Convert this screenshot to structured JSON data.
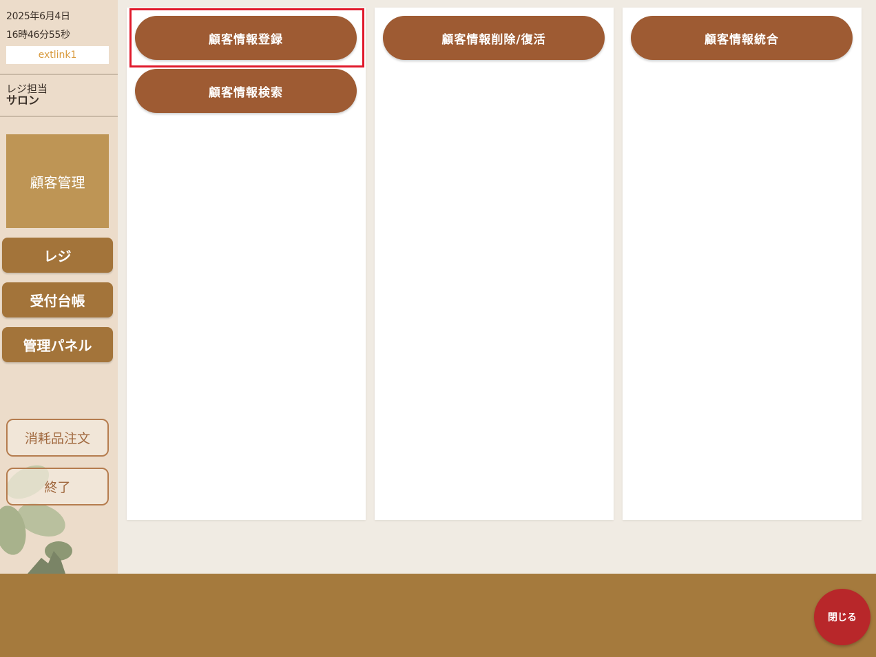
{
  "sidebar": {
    "date": "2025年6月4日",
    "time": "16時46分55秒",
    "user": "extlink1",
    "staff_label": "レジ担当",
    "staff_name": "サロン",
    "active_nav": "顧客管理",
    "nav": [
      {
        "label": "レジ"
      },
      {
        "label": "受付台帳"
      },
      {
        "label": "管理パネル"
      }
    ],
    "supply_order": "消耗品注文",
    "exit": "終了"
  },
  "panels": {
    "register": "顧客情報登録",
    "search": "顧客情報検索",
    "delete_restore": "顧客情報削除/復活",
    "merge": "顧客情報統合"
  },
  "footer": {
    "close": "閉じる"
  },
  "colors": {
    "sidebar_bg": "#ecdcca",
    "active_nav": "#be9555",
    "nav_button": "#a3743a",
    "pill_button": "#9e5b33",
    "footer": "#a57a3d",
    "close_button": "#b8272a",
    "highlight": "#e0182a"
  }
}
